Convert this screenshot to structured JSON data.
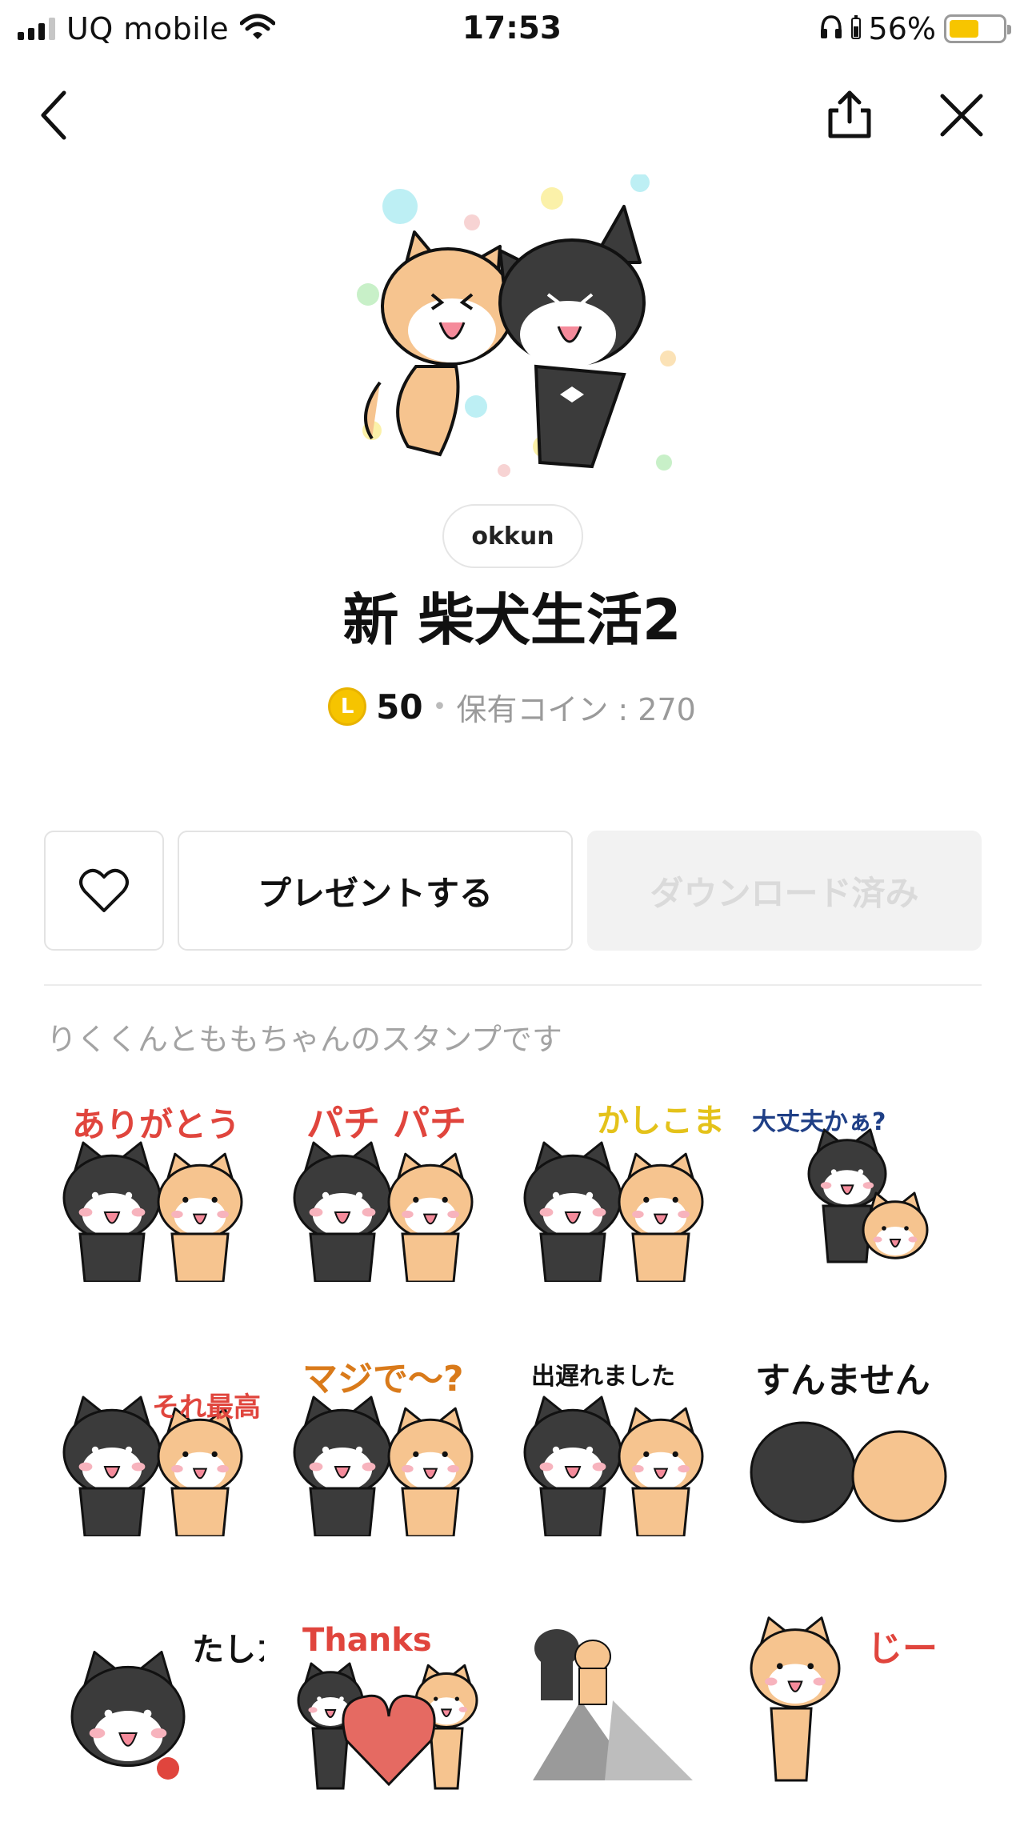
{
  "status_bar": {
    "carrier": "UQ mobile",
    "time": "17:53",
    "battery_percent": "56%",
    "battery_level": 0.56,
    "battery_color": "#f7c500"
  },
  "nav": {
    "back_icon": "chevron-left-icon",
    "share_icon": "share-icon",
    "close_icon": "close-icon"
  },
  "product": {
    "author": "okkun",
    "title": "新 柴犬生活2",
    "coin_symbol": "L",
    "price": "50",
    "separator": "•",
    "owned_coins": "保有コイン : 270",
    "description": "りくくんとももちゃんのスタンプです"
  },
  "actions": {
    "like_icon": "heart-icon",
    "present_label": "プレゼントする",
    "download_label": "ダウンロード済み"
  },
  "stickers": [
    {
      "text": "ありがとう"
    },
    {
      "text": "パチ パチ"
    },
    {
      "text": "かしこまり!"
    },
    {
      "text": "大丈夫かぁ?"
    },
    {
      "text": "それ最高!!"
    },
    {
      "text": "マジで〜?"
    },
    {
      "text": "出遅れました"
    },
    {
      "text": "すんません"
    },
    {
      "text": "たしカニ"
    },
    {
      "text": "Thanks"
    },
    {
      "text": ""
    },
    {
      "text": "じー"
    }
  ],
  "colors": {
    "shiba_orange": "#f6c48f",
    "shiba_black": "#3b3b3b",
    "accent_red": "#e0453d",
    "coin_gold": "#f6c400"
  }
}
